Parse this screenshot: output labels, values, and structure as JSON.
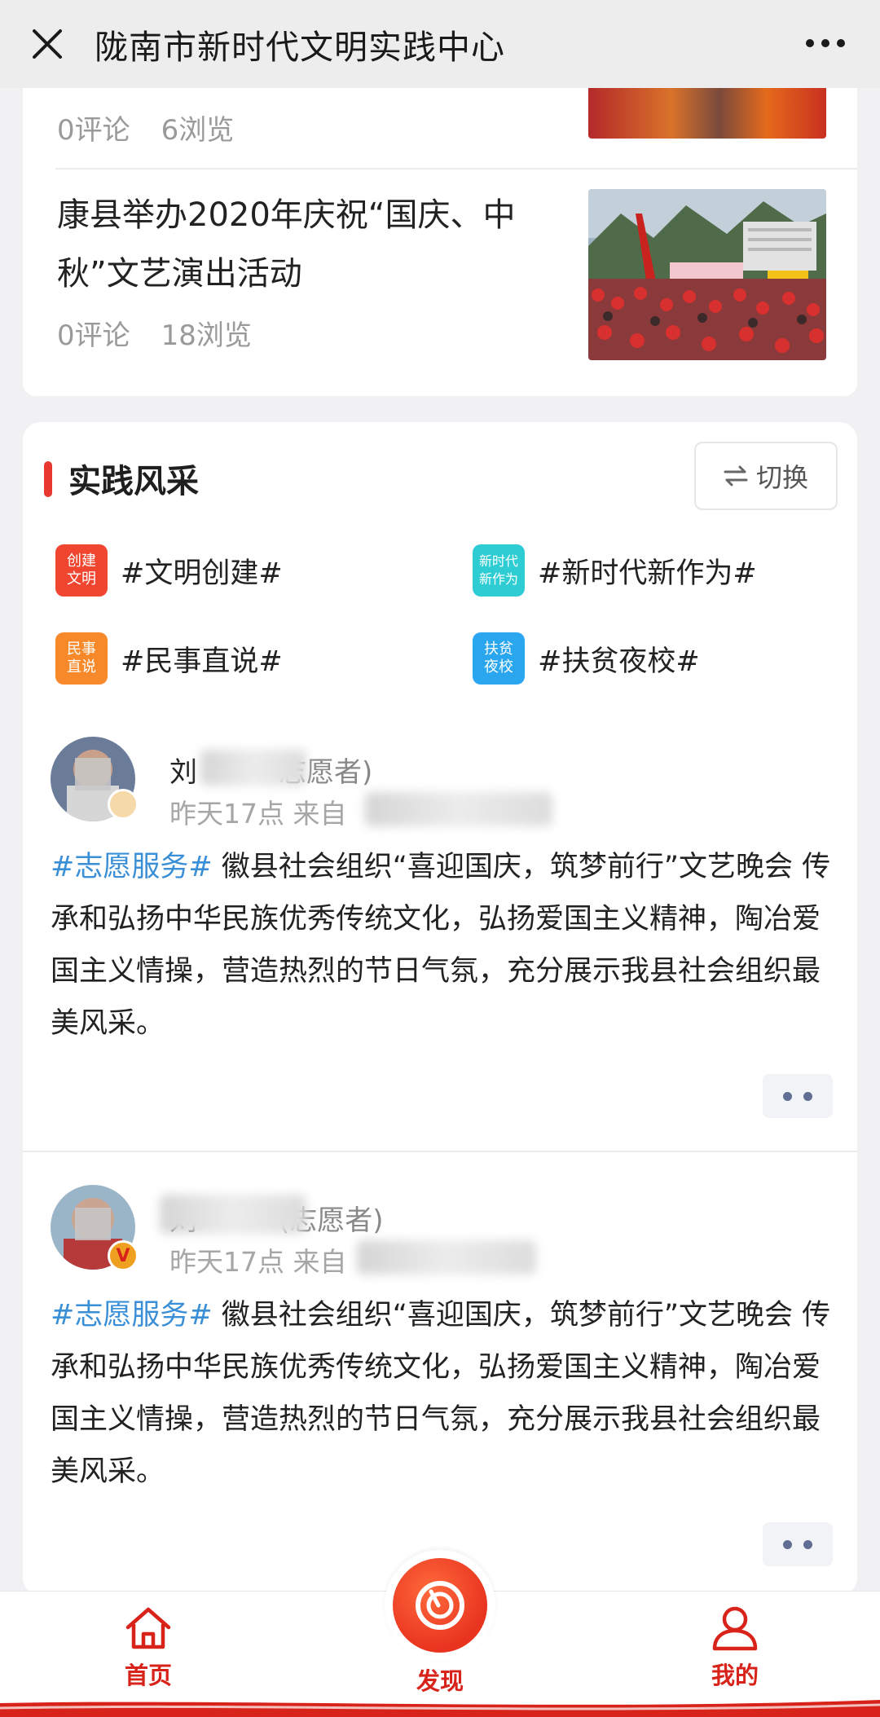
{
  "header": {
    "title": "陇南市新时代文明实践中心",
    "close_icon": "close-icon",
    "more_icon": "more-dots-icon"
  },
  "news": {
    "items": [
      {
        "title": "",
        "comments": "0评论",
        "views": "6浏览"
      },
      {
        "title": "康县举办2020年庆祝“国庆、中秋”文艺演出活动",
        "comments": "0评论",
        "views": "18浏览"
      }
    ]
  },
  "practice": {
    "title": "实践风采",
    "switch_label": "切换",
    "switch_icon": "swap-arrows-icon",
    "topics": [
      {
        "icon_text": "创建\n文明",
        "label": "#文明创建#",
        "color": "#f0452f"
      },
      {
        "icon_text": "新时代\n新作为",
        "label": "#新时代新作为#",
        "color": "#2ecdd4"
      },
      {
        "icon_text": "民事\n直说",
        "label": "#民事直说#",
        "color": "#f7892a"
      },
      {
        "icon_text": "扶贫\n夜校",
        "label": "#扶贫夜校#",
        "color": "#2aa6ee"
      }
    ],
    "posts": [
      {
        "name_visible": "刘",
        "role": "志愿者)",
        "time": "昨天17点 来自",
        "tag": "#志愿服务#",
        "body": " 徽县社会组织“喜迎国庆，筑梦前行”文艺晚会 传承和弘扬中华民族优秀传统文化，弘扬爱国主义精神，陶冶爱国主义情操，营造热烈的节日气氛，充分展示我县社会组织最美风采。"
      },
      {
        "name_visible": "刘",
        "role": "(志愿者)",
        "time": "昨天17点 来自",
        "badge": "V",
        "tag": "#志愿服务#",
        "body": " 徽县社会组织“喜迎国庆，筑梦前行”文艺晚会 传承和弘扬中华民族优秀传统文化，弘扬爱国主义精神，陶冶爱国主义情操，营造热烈的节日气氛，充分展示我县社会组织最美风采。"
      }
    ]
  },
  "nav": {
    "home": "首页",
    "discover": "发现",
    "mine": "我的"
  },
  "colors": {
    "accent": "#e8382f",
    "nav_red": "#d8231b",
    "tag_blue": "#3a8fd6"
  }
}
